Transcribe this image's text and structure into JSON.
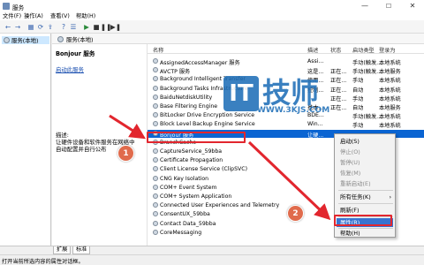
{
  "window": {
    "title": "服务",
    "min": "—",
    "max": "☐",
    "close": "✕"
  },
  "menu": [
    "文件(F)",
    "操作(A)",
    "查看(V)",
    "帮助(H)"
  ],
  "toolbar": [
    "back-icon",
    "forward-icon",
    "pane-icon",
    "refresh-icon",
    "export-icon",
    "help-icon",
    "list-icon",
    "play-icon",
    "stop-icon",
    "pause-icon",
    "restart-icon"
  ],
  "tree": {
    "item": "服务(本地)"
  },
  "band": {
    "title": "服务(本地)"
  },
  "detail": {
    "service_name": "Bonjour 服务",
    "start_link": "启动此服务",
    "desc_label": "描述:",
    "desc_text": "让硬件设备和软件服务在网络中自动配置并自行公布"
  },
  "list": {
    "headers": {
      "name": "名称",
      "desc": "描述",
      "status": "状态",
      "startup": "启动类型",
      "logon": "登录为"
    },
    "rows": [
      {
        "name": "AssignedAccessManager 服务",
        "desc": "Assi...",
        "status": "",
        "startup": "手动(触发...",
        "logon": "本地系统"
      },
      {
        "name": "AVCTP 服务",
        "desc": "这是...",
        "status": "正在...",
        "startup": "手动(触发...",
        "logon": "本地服务"
      },
      {
        "name": "Background Intelligent Transfer",
        "desc": "使用...",
        "status": "正在...",
        "startup": "手动",
        "logon": "本地系统"
      },
      {
        "name": "Background Tasks Infrastructure",
        "desc": "控制...",
        "status": "正在...",
        "startup": "自动",
        "logon": "本地系统"
      },
      {
        "name": "BaiduNetdiskUtility",
        "desc": "",
        "status": "正在...",
        "startup": "手动",
        "logon": "本地系统"
      },
      {
        "name": "Base Filtering Engine",
        "desc": "基本...",
        "status": "正在...",
        "startup": "自动",
        "logon": "本地服务"
      },
      {
        "name": "BitLocker Drive Encryption Service",
        "desc": "BDE...",
        "status": "",
        "startup": "手动(触发...",
        "logon": "本地系统"
      },
      {
        "name": "Block Level Backup Engine Service",
        "desc": "Win...",
        "status": "",
        "startup": "手动",
        "logon": "本地系统"
      },
      {
        "name": "Bonjour 服务",
        "desc": "让硬...",
        "status": "",
        "startup": "",
        "logon": ""
      },
      {
        "name": "BranchCache",
        "desc": "",
        "status": "",
        "startup": "",
        "logon": ""
      },
      {
        "name": "CaptureService_59bba",
        "desc": "",
        "status": "",
        "startup": "",
        "logon": ""
      },
      {
        "name": "Certificate Propagation",
        "desc": "",
        "status": "",
        "startup": "",
        "logon": ""
      },
      {
        "name": "Client License Service (ClipSVC)",
        "desc": "",
        "status": "",
        "startup": "",
        "logon": ""
      },
      {
        "name": "CNG Key Isolation",
        "desc": "",
        "status": "",
        "startup": "",
        "logon": ""
      },
      {
        "name": "COM+ Event System",
        "desc": "",
        "status": "",
        "startup": "",
        "logon": ""
      },
      {
        "name": "COM+ System Application",
        "desc": "",
        "status": "",
        "startup": "",
        "logon": ""
      },
      {
        "name": "Connected User Experiences and Telemetry",
        "desc": "",
        "status": "",
        "startup": "",
        "logon": ""
      },
      {
        "name": "ConsentUX_59bba",
        "desc": "",
        "status": "",
        "startup": "",
        "logon": ""
      },
      {
        "name": "Contact Data_59bba",
        "desc": "",
        "status": "",
        "startup": "",
        "logon": ""
      },
      {
        "name": "CoreMessaging",
        "desc": "",
        "status": "",
        "startup": "",
        "logon": ""
      }
    ],
    "selected_index": 8
  },
  "context_menu": {
    "items": [
      {
        "label": "启动(S)",
        "disabled": false
      },
      {
        "label": "停止(O)",
        "disabled": true
      },
      {
        "label": "暂停(U)",
        "disabled": true
      },
      {
        "label": "恢复(M)",
        "disabled": true
      },
      {
        "label": "重新启动(E)",
        "disabled": true
      },
      {
        "label": "所有任务(K)",
        "disabled": false,
        "arrow": "›"
      },
      {
        "label": "刷新(F)",
        "disabled": false
      },
      {
        "label": "属性(R)",
        "disabled": false,
        "highlighted": true
      },
      {
        "label": "帮助(H)",
        "disabled": false
      }
    ]
  },
  "tabs": [
    "扩展",
    "标准"
  ],
  "status": "打开当前所选内容的属性对话框。",
  "annotations": {
    "step1": "1",
    "step2": "2"
  },
  "watermark": {
    "logo": "IT",
    "text": "技师",
    "url": "WWW.3KJS.COM"
  },
  "colors": {
    "accent": "#e2262e",
    "selection": "#0a64d2",
    "badge": "#e06b4c",
    "watermark": "#1f6fb8"
  }
}
